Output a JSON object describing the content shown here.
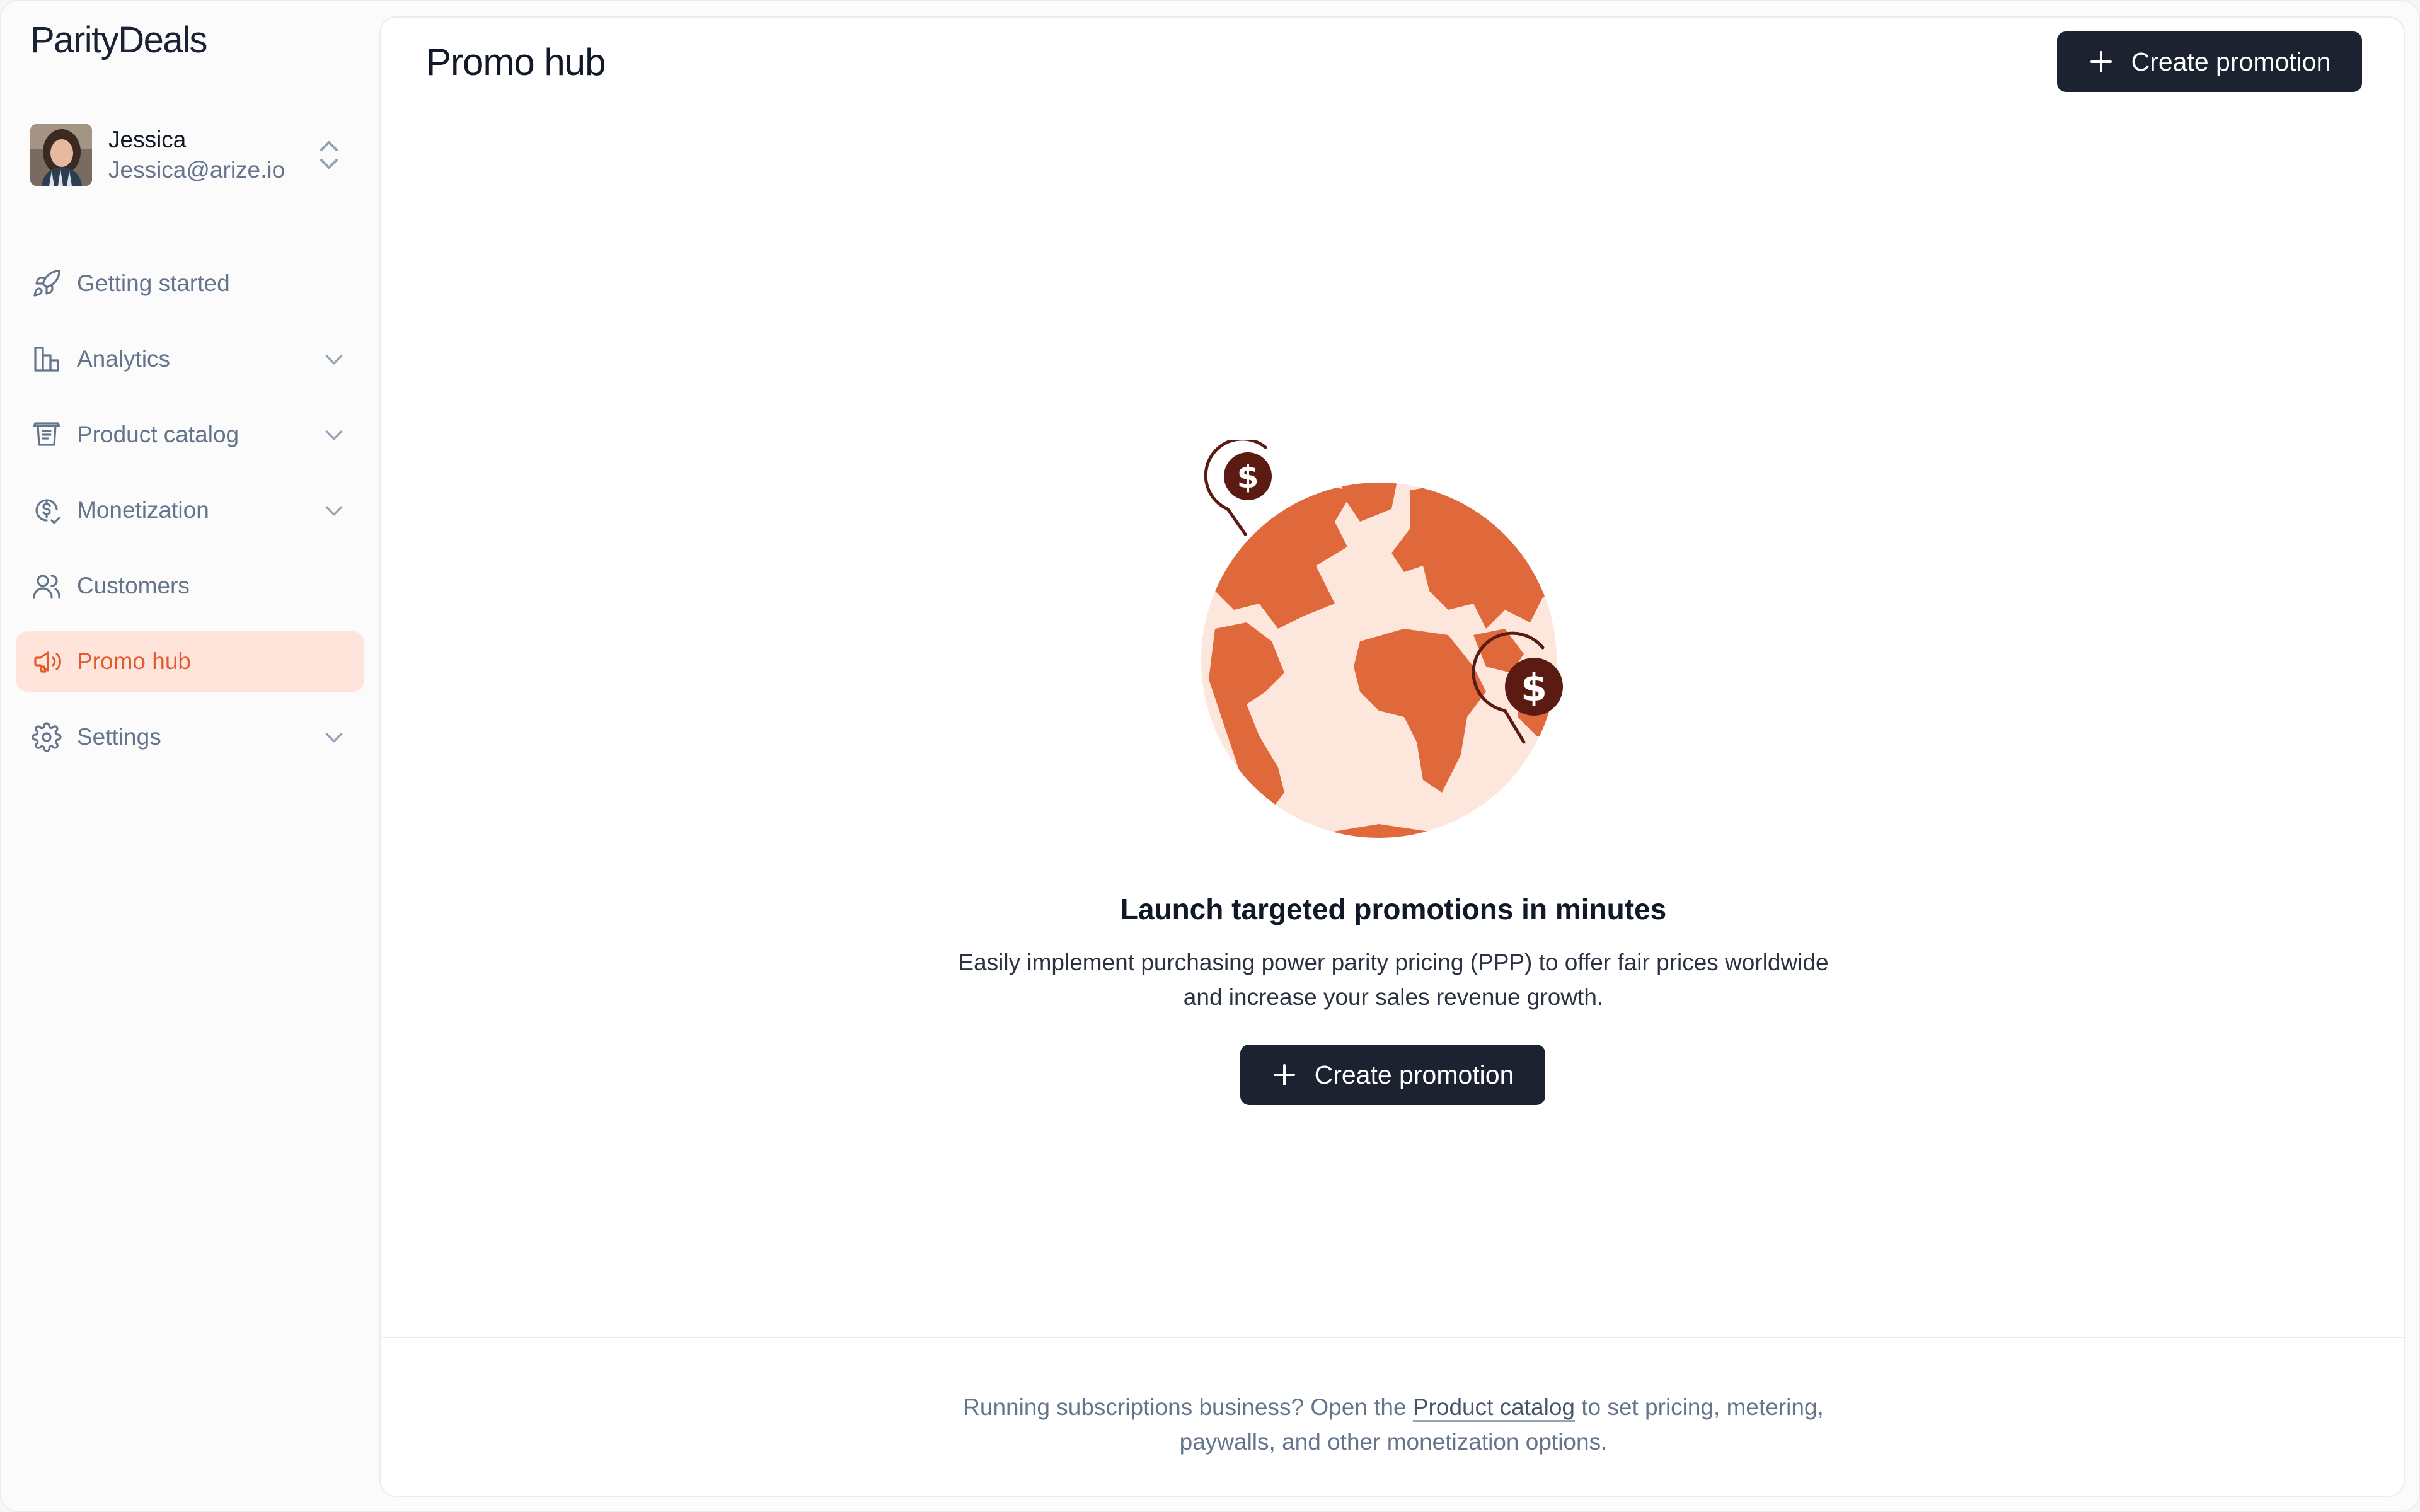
{
  "app": {
    "logo": "ParityDeals"
  },
  "user": {
    "name": "Jessica",
    "email": "Jessica@arize.io"
  },
  "sidebar": {
    "items": [
      {
        "label": "Getting started",
        "icon": "rocket-icon",
        "expandable": false,
        "active": false
      },
      {
        "label": "Analytics",
        "icon": "bar-chart-icon",
        "expandable": true,
        "active": false
      },
      {
        "label": "Product catalog",
        "icon": "catalog-icon",
        "expandable": true,
        "active": false
      },
      {
        "label": "Monetization",
        "icon": "dollar-cycle-icon",
        "expandable": true,
        "active": false
      },
      {
        "label": "Customers",
        "icon": "users-icon",
        "expandable": false,
        "active": false
      },
      {
        "label": "Promo hub",
        "icon": "megaphone-icon",
        "expandable": false,
        "active": true
      },
      {
        "label": "Settings",
        "icon": "gear-icon",
        "expandable": true,
        "active": false
      }
    ]
  },
  "header": {
    "title": "Promo hub",
    "create_label": "Create promotion"
  },
  "empty_state": {
    "title": "Launch targeted promotions in minutes",
    "description_line1": "Easily implement purchasing power parity pricing (PPP) to offer fair prices worldwide",
    "description_line2": "and increase your sales revenue growth.",
    "button_label": "Create promotion",
    "illustration": "globe-with-dollar-pins"
  },
  "footer": {
    "text_before": "Running subscriptions business? Open the ",
    "link": "Product catalog",
    "text_after": " to set pricing, metering,",
    "line2": "paywalls, and other monetization options."
  },
  "colors": {
    "accent": "#e45a2a",
    "active_bg": "#ffe4dc",
    "button_bg": "#1c2230",
    "globe_land": "#e0693b",
    "globe_sea": "#fde6dc",
    "pin": "#5b1a12"
  }
}
